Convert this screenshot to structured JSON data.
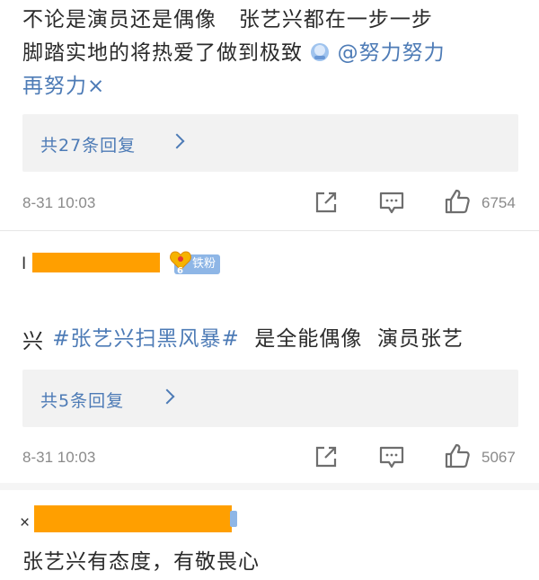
{
  "comments": [
    {
      "text_line1": "不论是演员还是偶像   张艺兴都在一步一步",
      "text_line2_plain": "脚踏实地的将热爱了做到极致",
      "text_line2_mention": "@努力努力",
      "text_line3_link": "再努力×",
      "reply_label": "共27条回复",
      "time": "8-31  10:03",
      "likes": "6754"
    },
    {
      "username_prefix": "I",
      "badge_level": "6",
      "badge_label": "铁粉",
      "hashtag": "#张艺兴扫黑风暴#",
      "text_rest": "  是全能偶像  演员张艺",
      "text_line2": "兴",
      "reply_label": "共5条回复",
      "time": "8-31  10:03",
      "likes": "5067"
    },
    {
      "username_prefix": "×",
      "text": "张艺兴有态度，有敬畏心"
    }
  ],
  "icons": {
    "share": "share-icon",
    "comment": "comment-icon",
    "like": "thumbs-up-icon",
    "chevron": "chevron-right-icon",
    "emoji": "emoji-icon"
  },
  "colors": {
    "link": "#4d7bb6",
    "redaction": "#ff9f00",
    "badge": "#8eb6e6"
  }
}
